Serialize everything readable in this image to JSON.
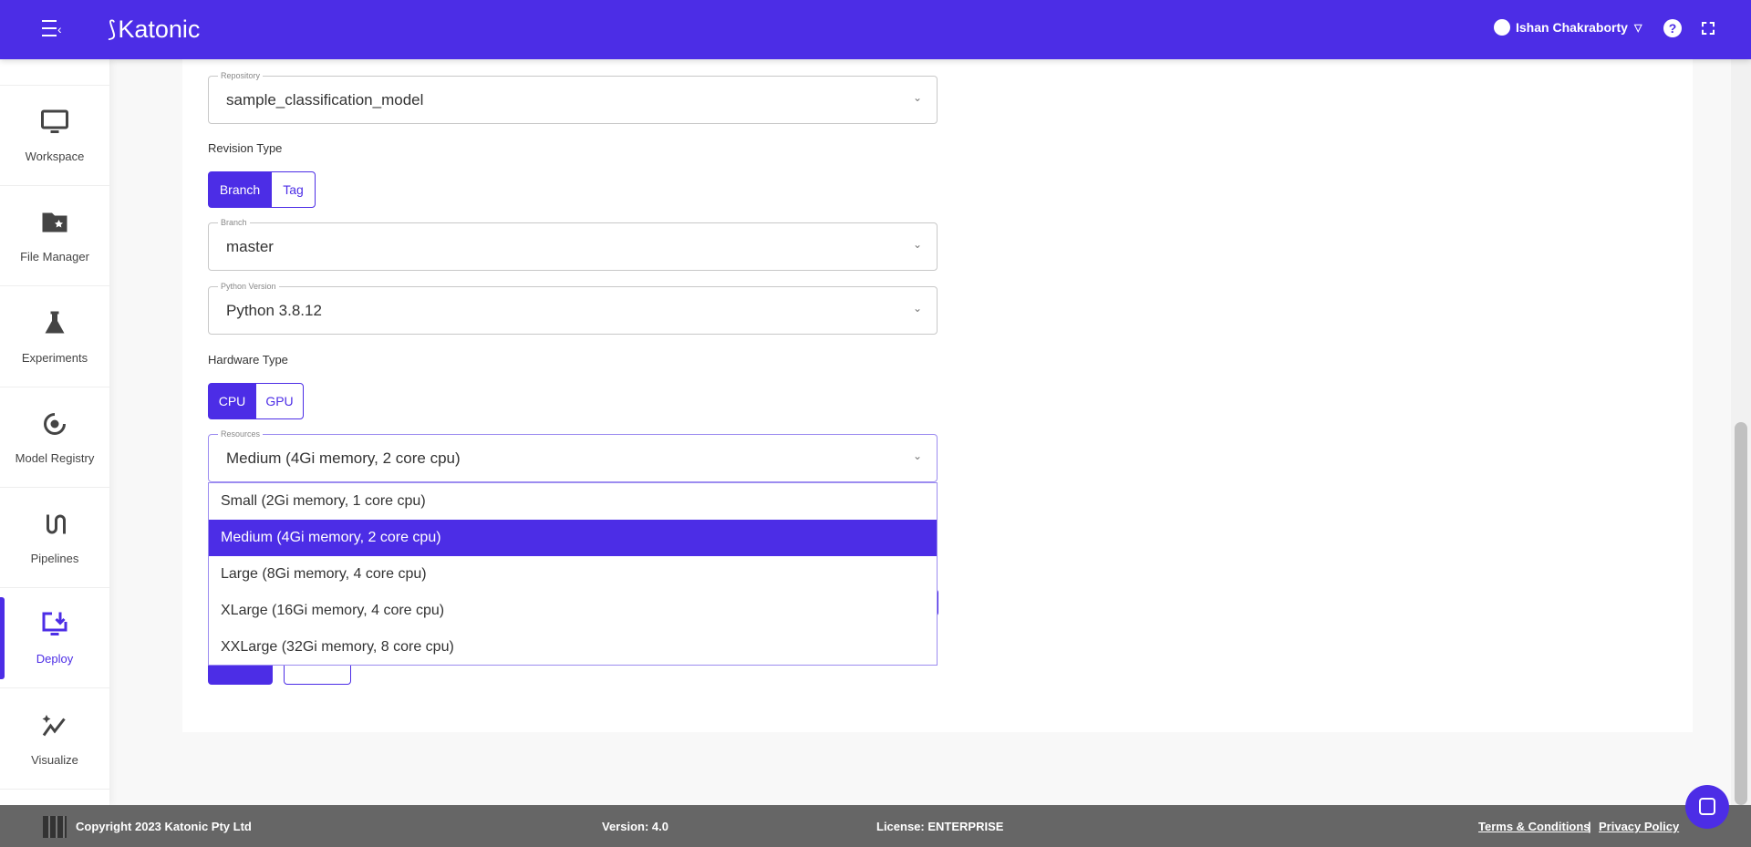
{
  "header": {
    "brand": "Katonic",
    "user": "Ishan Chakraborty"
  },
  "sidebar": {
    "items": [
      {
        "label": "Workspace",
        "icon": "monitor-icon"
      },
      {
        "label": "File Manager",
        "icon": "folder-star-icon"
      },
      {
        "label": "Experiments",
        "icon": "flask-icon"
      },
      {
        "label": "Model Registry",
        "icon": "model-registry-icon"
      },
      {
        "label": "Pipelines",
        "icon": "pipeline-icon"
      },
      {
        "label": "Deploy",
        "icon": "deploy-icon",
        "active": true
      },
      {
        "label": "Visualize",
        "icon": "sparkle-chart-icon"
      }
    ]
  },
  "form": {
    "repository": {
      "label": "Repository",
      "value": "sample_classification_model"
    },
    "revision_type": {
      "label": "Revision Type",
      "options": [
        "Branch",
        "Tag"
      ],
      "selected": "Branch"
    },
    "branch": {
      "label": "Branch",
      "value": "master"
    },
    "python": {
      "label": "Python Version",
      "value": "Python 3.8.12"
    },
    "hardware_type": {
      "label": "Hardware Type",
      "options": [
        "CPU",
        "GPU"
      ],
      "selected": "CPU"
    },
    "resources": {
      "label": "Resources",
      "value": "Medium (4Gi memory, 2 core cpu)",
      "options": [
        "Small (2Gi memory, 1 core cpu)",
        "Medium (4Gi memory, 2 core cpu)",
        "Large (8Gi memory, 4 core cpu)",
        "XLarge (16Gi memory, 4 core cpu)",
        "XXLarge (32Gi memory, 8 core cpu)"
      ]
    }
  },
  "footer": {
    "copyright": "Copyright 2023 Katonic Pty Ltd",
    "version": "Version: 4.0",
    "license": "License: ENTERPRISE",
    "terms": "Terms & Conditions",
    "sep": "|",
    "privacy": "Privacy Policy"
  },
  "colors": {
    "accent": "#4c2de6",
    "footer": "#666666"
  }
}
